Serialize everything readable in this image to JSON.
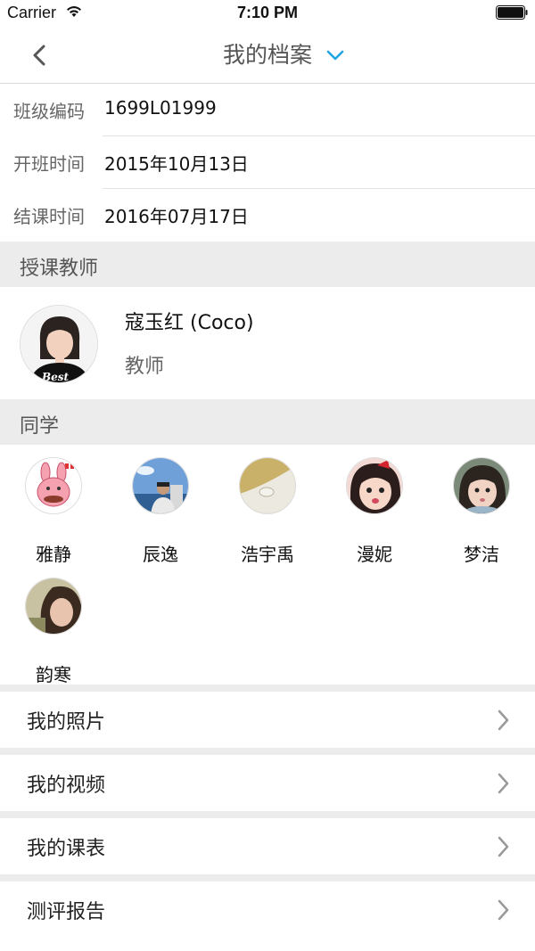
{
  "status_bar": {
    "carrier": "Carrier",
    "time": "7:10 PM"
  },
  "nav": {
    "title": "我的档案",
    "back_icon": "chevron-left-icon",
    "dropdown_icon": "chevron-down-icon"
  },
  "info": [
    {
      "label": "班级编码",
      "value": "1699L01999"
    },
    {
      "label": "开班时间",
      "value": "2015年10月13日"
    },
    {
      "label": "结课时间",
      "value": "2016年07月17日"
    }
  ],
  "sections": {
    "teacher": "授课教师",
    "classmates": "同学"
  },
  "teacher": {
    "name": "寇玉红 (Coco)",
    "role": "教师"
  },
  "classmates": [
    {
      "name": "雅静"
    },
    {
      "name": "辰逸"
    },
    {
      "name": "浩宇禹"
    },
    {
      "name": "漫妮"
    },
    {
      "name": "梦洁"
    },
    {
      "name": "韵寒"
    }
  ],
  "menu": [
    {
      "label": "我的照片"
    },
    {
      "label": "我的视频"
    },
    {
      "label": "我的课表"
    },
    {
      "label": "测评报告"
    }
  ],
  "colors": {
    "accent": "#1aa3e0",
    "section_bg": "#ececec",
    "chevron": "#999999"
  }
}
